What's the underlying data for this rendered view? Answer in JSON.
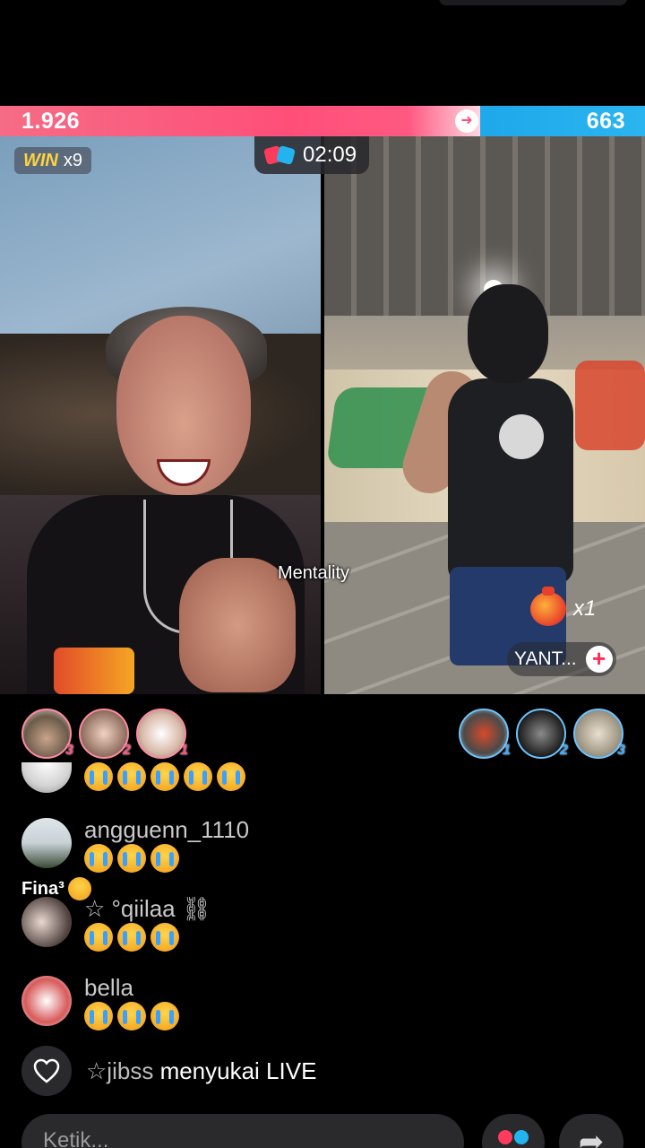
{
  "pk": {
    "left_score": "1.926",
    "right_score": "663",
    "left_fraction": 0.744,
    "win_label": "WIN",
    "win_count": "x9",
    "timer": "02:09"
  },
  "stream": {
    "caption": "Mentality",
    "gift_multiplier": "x1",
    "host_name": "YANT...",
    "follow_symbol": "+"
  },
  "supporters": {
    "left": [
      {
        "rank": "3"
      },
      {
        "rank": "2"
      },
      {
        "rank": "1"
      }
    ],
    "right": [
      {
        "rank": "1"
      },
      {
        "rank": "2"
      },
      {
        "rank": "3"
      }
    ]
  },
  "comments": [
    {
      "name": "",
      "emoji_count": 5
    },
    {
      "name": "angguenn_1110",
      "emoji_count": 3
    },
    {
      "name": "☆ °qiilaa ⛓",
      "emoji_count": 3
    },
    {
      "name": "bella",
      "emoji_count": 3
    }
  ],
  "fina_tag": "Fina³",
  "like_activity": {
    "who": "☆jibss",
    "text": "menyukai LIVE"
  },
  "input": {
    "placeholder": "Ketik..."
  },
  "colors": {
    "left_team": "#ff4f79",
    "right_team": "#23b4f0",
    "win_gold": "#ffd23e"
  },
  "icons": {
    "pk": "pk-versus-icon",
    "like": "heart-outline-icon",
    "gift": "gift-icon",
    "share": "share-arrow-icon",
    "follow": "plus-icon",
    "emoji": "loudly-crying-face-icon"
  }
}
